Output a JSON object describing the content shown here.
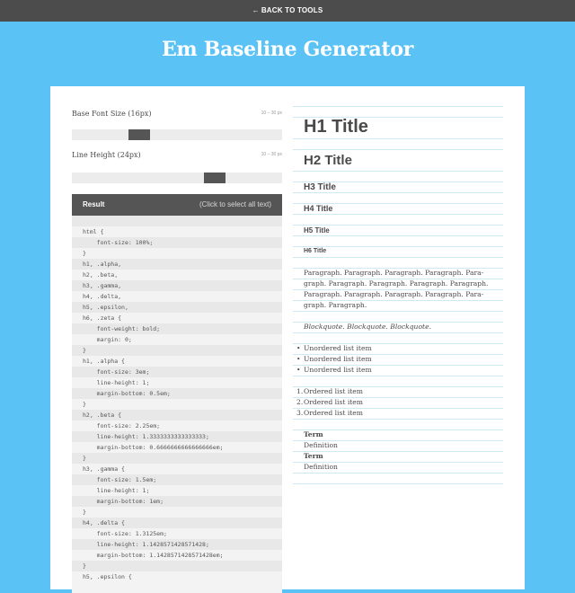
{
  "topbar": {
    "back_label": "BACK TO TOOLS",
    "back_icon": "left-arrow-icon"
  },
  "page": {
    "title": "Em Baseline Generator"
  },
  "controls": {
    "font_size": {
      "label": "Base Font Size (16px)",
      "range": "10 – 30 px",
      "value": 16,
      "min": 10,
      "max": 30
    },
    "line_height": {
      "label": "Line Height (24px)",
      "range": "10 – 30 px",
      "value": 24,
      "min": 10,
      "max": 30
    }
  },
  "result": {
    "title": "Result",
    "hint": "(Click to select all text)",
    "lines": [
      "",
      "html {",
      "    font-size: 100%;",
      "}",
      "h1, .alpha,",
      "h2, .beta,",
      "h3, .gamma,",
      "h4, .delta,",
      "h5, .epsilon,",
      "h6, .zeta {",
      "    font-weight: bold;",
      "    margin: 0;",
      "}",
      "h1, .alpha {",
      "    font-size: 3em;",
      "    line-height: 1;",
      "    margin-bottom: 0.5em;",
      "}",
      "h2, .beta {",
      "    font-size: 2.25em;",
      "    line-height: 1.3333333333333333;",
      "    margin-bottom: 0.6666666666666666em;",
      "}",
      "h3, .gamma {",
      "    font-size: 1.5em;",
      "    line-height: 1;",
      "    margin-bottom: 1em;",
      "}",
      "h4, .delta {",
      "    font-size: 1.3125em;",
      "    line-height: 1.1428571428571428;",
      "    margin-bottom: 1.1428571428571428em;",
      "}",
      "h5, .epsilon {"
    ]
  },
  "preview": {
    "h1": "H1 Title",
    "h2": "H2 Title",
    "h3": "H3 Title",
    "h4": "H4 Title",
    "h5": "H5 Title",
    "h6": "H6 Title",
    "paragraph_lines": [
      "Paragraph. Paragraph. Paragraph. Paragraph. Para-",
      "graph. Paragraph. Paragraph. Paragraph. Paragraph.",
      "Paragraph. Paragraph. Paragraph. Paragraph. Para-",
      "graph. Paragraph."
    ],
    "blockquote": "Blockquote. Blockquote. Blockquote.",
    "unordered": [
      "Unordered list item",
      "Unordered list item",
      "Unordered list item"
    ],
    "ordered": [
      "Ordered list item",
      "Ordered list item",
      "Ordered list item"
    ],
    "ordered_markers": [
      "1.",
      "2.",
      "3."
    ],
    "definitions": [
      {
        "term": "Term",
        "definition": "Definition"
      },
      {
        "term": "Term",
        "definition": "Definition"
      }
    ]
  },
  "colors": {
    "background": "#5bc2f5",
    "topbar": "#4c4c4c",
    "result_header": "#555555",
    "baseline": "#cfe9f7"
  }
}
